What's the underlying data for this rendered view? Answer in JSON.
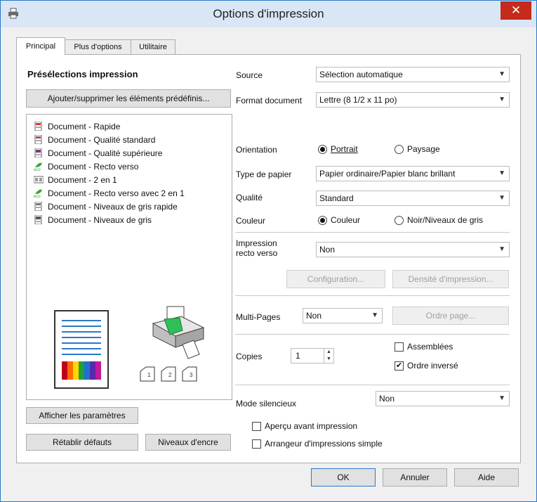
{
  "window": {
    "title": "Options d'impression",
    "close_glyph": "✕"
  },
  "tabs": [
    {
      "label": "Principal",
      "active": true
    },
    {
      "label": "Plus d'options",
      "active": false
    },
    {
      "label": "Utilitaire",
      "active": false
    }
  ],
  "presets": {
    "heading": "Présélections impression",
    "manage_button": "Ajouter/supprimer les éléments prédéfinis...",
    "items": [
      {
        "label": "Document - Rapide",
        "icon": "document-fast-icon"
      },
      {
        "label": "Document - Qualité standard",
        "icon": "document-standard-icon"
      },
      {
        "label": "Document - Qualité supérieure",
        "icon": "document-high-icon"
      },
      {
        "label": "Document - Recto verso",
        "icon": "eco-icon"
      },
      {
        "label": "Document - 2 en 1",
        "icon": "two-up-icon"
      },
      {
        "label": "Document - Recto verso avec 2 en 1",
        "icon": "eco-icon"
      },
      {
        "label": "Document - Niveaux de gris rapide",
        "icon": "grayscale-fast-icon"
      },
      {
        "label": "Document - Niveaux de gris",
        "icon": "grayscale-icon"
      }
    ]
  },
  "left_buttons": {
    "show_settings": "Afficher les paramètres",
    "restore_defaults": "Rétablir défauts",
    "ink_levels": "Niveaux d'encre"
  },
  "form": {
    "source": {
      "label": "Source",
      "value": "Sélection automatique"
    },
    "format": {
      "label": "Format document",
      "value": "Lettre (8 1/2 x 11 po)"
    },
    "orientation": {
      "label": "Orientation",
      "portrait": "Portrait",
      "landscape": "Paysage",
      "selected": "portrait"
    },
    "paper_type": {
      "label": "Type de papier",
      "value": "Papier ordinaire/Papier blanc brillant"
    },
    "quality": {
      "label": "Qualité",
      "value": "Standard"
    },
    "color": {
      "label": "Couleur",
      "color": "Couleur",
      "grayscale": "Noir/Niveaux de gris",
      "selected": "color"
    },
    "duplex": {
      "label_line1": "Impression",
      "label_line2": "recto verso",
      "value": "Non"
    },
    "config_button": "Configuration...",
    "density_button": "Densité d'impression...",
    "multipage": {
      "label": "Multi-Pages",
      "value": "Non"
    },
    "page_order_button": "Ordre page...",
    "copies": {
      "label": "Copies",
      "value": "1"
    },
    "collate": {
      "label": "Assemblées",
      "checked": false
    },
    "reverse": {
      "label": "Ordre inversé",
      "checked": true
    },
    "quiet": {
      "label": "Mode silencieux",
      "value": "Non"
    },
    "preview": {
      "label": "Aperçu avant impression",
      "checked": false
    },
    "arranger": {
      "label": "Arrangeur d'impressions simple",
      "checked": false
    }
  },
  "footer": {
    "ok": "OK",
    "cancel": "Annuler",
    "help": "Aide"
  },
  "colors": {
    "accent": "#2b79c8",
    "close": "#c42b1c",
    "eco": "#3aa335"
  }
}
